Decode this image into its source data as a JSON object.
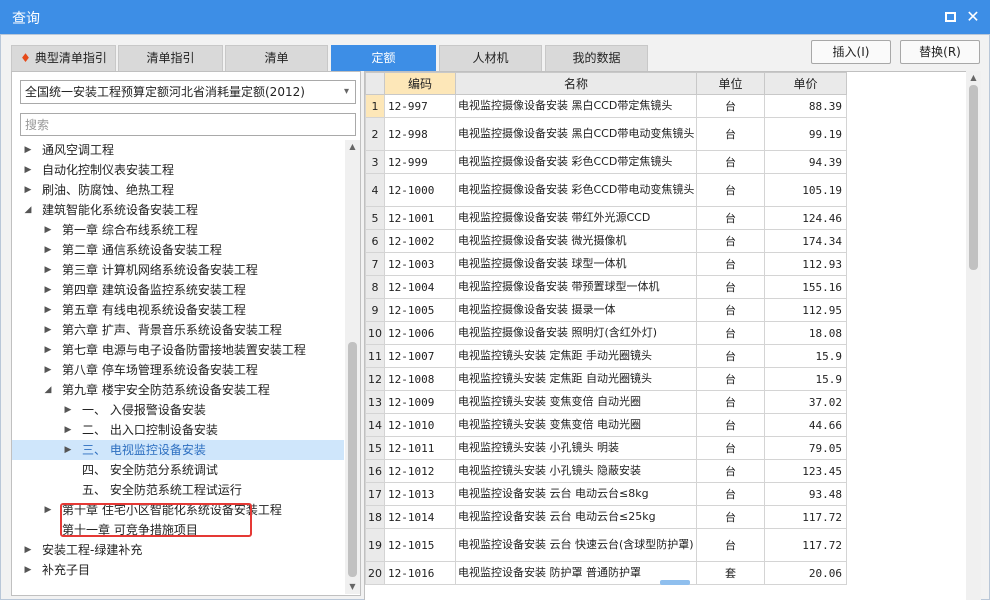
{
  "window": {
    "title": "查询",
    "maximize_icon": "maximize-icon",
    "close_icon": "close-icon",
    "accent_color": "#3d8ee6"
  },
  "tabs": [
    {
      "label": "典型清单指引",
      "icon": "fire-icon",
      "active": false
    },
    {
      "label": "清单指引",
      "active": false
    },
    {
      "label": "清单",
      "active": false
    },
    {
      "label": "定额",
      "active": true
    },
    {
      "label": "人材机",
      "active": false
    },
    {
      "label": "我的数据",
      "active": false
    }
  ],
  "actions": {
    "insert_label": "插入(I)",
    "replace_label": "替换(R)"
  },
  "left": {
    "library_select": "全国统一安装工程预算定额河北省消耗量定额(2012)",
    "search_placeholder": "搜索"
  },
  "tree": [
    {
      "label": "通风空调工程",
      "level": 0,
      "state": "collapsed"
    },
    {
      "label": "自动化控制仪表安装工程",
      "level": 0,
      "state": "collapsed"
    },
    {
      "label": "刷油、防腐蚀、绝热工程",
      "level": 0,
      "state": "collapsed"
    },
    {
      "label": "建筑智能化系统设备安装工程",
      "level": 0,
      "state": "expanded"
    },
    {
      "label": "第一章 综合布线系统工程",
      "level": 1,
      "state": "collapsed"
    },
    {
      "label": "第二章 通信系统设备安装工程",
      "level": 1,
      "state": "collapsed"
    },
    {
      "label": "第三章 计算机网络系统设备安装工程",
      "level": 1,
      "state": "collapsed"
    },
    {
      "label": "第四章 建筑设备监控系统安装工程",
      "level": 1,
      "state": "collapsed"
    },
    {
      "label": "第五章 有线电视系统设备安装工程",
      "level": 1,
      "state": "collapsed"
    },
    {
      "label": "第六章 扩声、背景音乐系统设备安装工程",
      "level": 1,
      "state": "collapsed"
    },
    {
      "label": "第七章 电源与电子设备防雷接地装置安装工程",
      "level": 1,
      "state": "collapsed"
    },
    {
      "label": "第八章 停车场管理系统设备安装工程",
      "level": 1,
      "state": "collapsed"
    },
    {
      "label": "第九章 楼宇安全防范系统设备安装工程",
      "level": 1,
      "state": "expanded"
    },
    {
      "label": "一、 入侵报警设备安装",
      "level": 2,
      "state": "collapsed"
    },
    {
      "label": "二、 出入口控制设备安装",
      "level": 2,
      "state": "collapsed"
    },
    {
      "label": "三、 电视监控设备安装",
      "level": 2,
      "state": "collapsed",
      "selected": true
    },
    {
      "label": "四、 安全防范分系统调试",
      "level": 2,
      "state": "leaf"
    },
    {
      "label": "五、 安全防范系统工程试运行",
      "level": 2,
      "state": "leaf"
    },
    {
      "label": "第十章 住宅小区智能化系统设备安装工程",
      "level": 1,
      "state": "collapsed"
    },
    {
      "label": "第十一章 可竞争措施项目",
      "level": 1,
      "state": "leaf"
    },
    {
      "label": "安装工程-绿建补充",
      "level": 0,
      "state": "collapsed"
    },
    {
      "label": "补充子目",
      "level": 0,
      "state": "collapsed"
    }
  ],
  "table": {
    "columns": [
      "编码",
      "名称",
      "单位",
      "单价"
    ],
    "rows": [
      {
        "idx": "1",
        "code": "12-997",
        "name": "电视监控摄像设备安装 黑白CCD带定焦镜头",
        "unit": "台",
        "price": "88.39",
        "selected": true
      },
      {
        "idx": "2",
        "code": "12-998",
        "name": "电视监控摄像设备安装 黑白CCD带电动变焦镜头",
        "unit": "台",
        "price": "99.19"
      },
      {
        "idx": "3",
        "code": "12-999",
        "name": "电视监控摄像设备安装 彩色CCD带定焦镜头",
        "unit": "台",
        "price": "94.39"
      },
      {
        "idx": "4",
        "code": "12-1000",
        "name": "电视监控摄像设备安装 彩色CCD带电动变焦镜头",
        "unit": "台",
        "price": "105.19"
      },
      {
        "idx": "5",
        "code": "12-1001",
        "name": "电视监控摄像设备安装 带红外光源CCD",
        "unit": "台",
        "price": "124.46"
      },
      {
        "idx": "6",
        "code": "12-1002",
        "name": "电视监控摄像设备安装 微光摄像机",
        "unit": "台",
        "price": "174.34"
      },
      {
        "idx": "7",
        "code": "12-1003",
        "name": "电视监控摄像设备安装 球型一体机",
        "unit": "台",
        "price": "112.93"
      },
      {
        "idx": "8",
        "code": "12-1004",
        "name": "电视监控摄像设备安装 带预置球型一体机",
        "unit": "台",
        "price": "155.16"
      },
      {
        "idx": "9",
        "code": "12-1005",
        "name": "电视监控摄像设备安装 摄录一体",
        "unit": "台",
        "price": "112.95"
      },
      {
        "idx": "10",
        "code": "12-1006",
        "name": "电视监控摄像设备安装 照明灯(含红外灯)",
        "unit": "台",
        "price": "18.08"
      },
      {
        "idx": "11",
        "code": "12-1007",
        "name": "电视监控镜头安装 定焦距 手动光圈镜头",
        "unit": "台",
        "price": "15.9"
      },
      {
        "idx": "12",
        "code": "12-1008",
        "name": "电视监控镜头安装 定焦距 自动光圈镜头",
        "unit": "台",
        "price": "15.9"
      },
      {
        "idx": "13",
        "code": "12-1009",
        "name": "电视监控镜头安装 变焦变倍 自动光圈",
        "unit": "台",
        "price": "37.02"
      },
      {
        "idx": "14",
        "code": "12-1010",
        "name": "电视监控镜头安装 变焦变倍 电动光圈",
        "unit": "台",
        "price": "44.66"
      },
      {
        "idx": "15",
        "code": "12-1011",
        "name": "电视监控镜头安装 小孔镜头 明装",
        "unit": "台",
        "price": "79.05"
      },
      {
        "idx": "16",
        "code": "12-1012",
        "name": "电视监控镜头安装 小孔镜头 隐蔽安装",
        "unit": "台",
        "price": "123.45"
      },
      {
        "idx": "17",
        "code": "12-1013",
        "name": "电视监控设备安装 云台 电动云台≤8kg",
        "unit": "台",
        "price": "93.48"
      },
      {
        "idx": "18",
        "code": "12-1014",
        "name": "电视监控设备安装 云台 电动云台≤25kg",
        "unit": "台",
        "price": "117.72"
      },
      {
        "idx": "19",
        "code": "12-1015",
        "name": "电视监控设备安装 云台 快速云台(含球型防护罩)",
        "unit": "台",
        "price": "117.72"
      },
      {
        "idx": "20",
        "code": "12-1016",
        "name": "电视监控设备安装 防护罩 普通防护罩",
        "unit": "套",
        "price": "20.06"
      }
    ]
  }
}
